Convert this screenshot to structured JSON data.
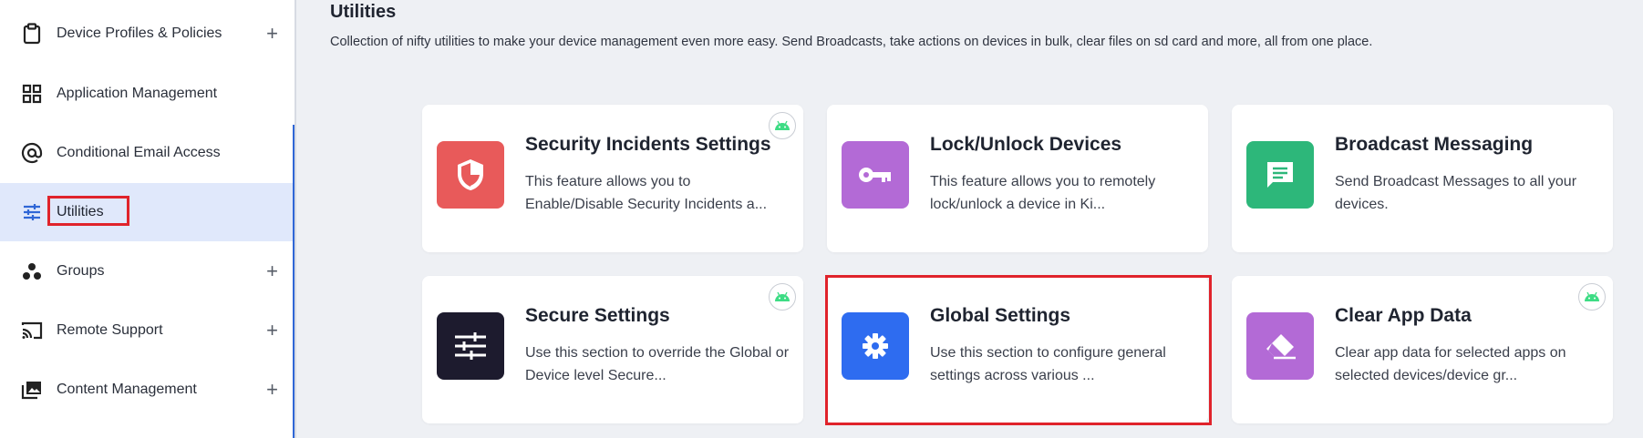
{
  "sidebar": {
    "items": [
      {
        "label": "Device Profiles & Policies",
        "icon": "clipboard-icon",
        "expandable": true
      },
      {
        "label": "Application Management",
        "icon": "grid-icon",
        "expandable": false
      },
      {
        "label": "Conditional Email Access",
        "icon": "at-sign-icon",
        "expandable": false
      },
      {
        "label": "Utilities",
        "icon": "sliders-icon",
        "expandable": false,
        "active": true
      },
      {
        "label": "Groups",
        "icon": "groups-icon",
        "expandable": true
      },
      {
        "label": "Remote Support",
        "icon": "cast-icon",
        "expandable": true
      },
      {
        "label": "Content Management",
        "icon": "photo-library-icon",
        "expandable": true
      }
    ],
    "plus": "+"
  },
  "main": {
    "title": "Utilities",
    "description": "Collection of nifty utilities to make your device management even more easy. Send Broadcasts, take actions on devices in bulk, clear files on sd card and more, all from one place."
  },
  "cards": [
    {
      "title": "Security Incidents Settings",
      "desc": "This feature allows you to Enable/Disable Security Incidents a...",
      "icon": "shield-icon",
      "color": "#e85a5a",
      "android": true
    },
    {
      "title": "Lock/Unlock Devices",
      "desc": "This feature allows you to remotely lock/unlock a device in Ki...",
      "icon": "key-icon",
      "color": "#b36ad6",
      "android": false
    },
    {
      "title": "Broadcast Messaging",
      "desc": "Send Broadcast Messages to all your devices.",
      "icon": "message-icon",
      "color": "#2db77a",
      "android": false
    },
    {
      "title": "Secure Settings",
      "desc": "Use this section to override the Global or Device level Secure...",
      "icon": "sliders-icon",
      "color": "#1d1b2e",
      "android": true
    },
    {
      "title": "Global Settings",
      "desc": "Use this section to configure general settings across various ...",
      "icon": "gear-icon",
      "color": "#2e6cf0",
      "android": false
    },
    {
      "title": "Clear App Data",
      "desc": "Clear app data for selected apps on selected devices/device gr...",
      "icon": "eraser-icon",
      "color": "#b36ad6",
      "android": true
    }
  ],
  "colors": {
    "accent": "#2f66d6",
    "highlight": "#e0232b",
    "android": "#3ddc84"
  }
}
